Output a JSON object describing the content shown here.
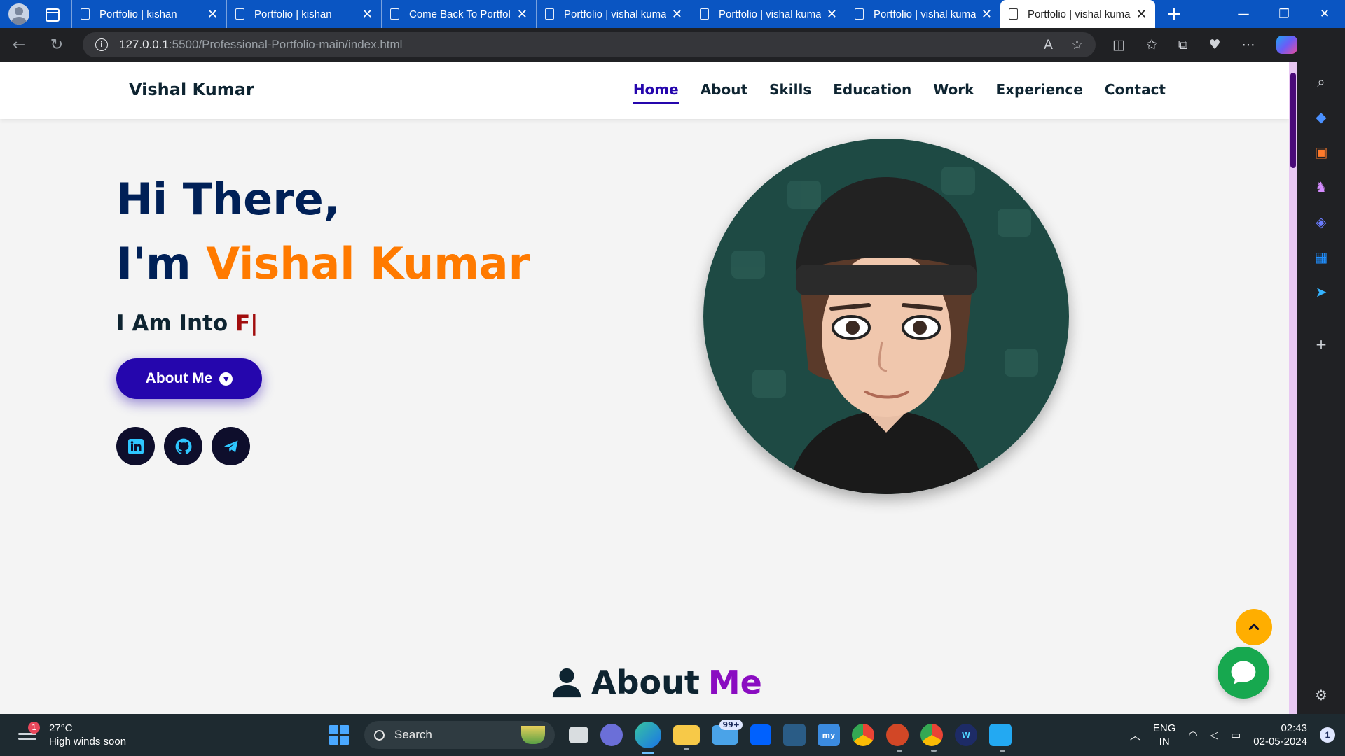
{
  "browser": {
    "tabs": [
      {
        "title": "Portfolio | kishan",
        "active": false
      },
      {
        "title": "Portfolio | kishan",
        "active": false
      },
      {
        "title": "Come Back To Portfolio",
        "active": false
      },
      {
        "title": "Portfolio | vishal kumar",
        "active": false
      },
      {
        "title": "Portfolio | vishal kumar",
        "active": false
      },
      {
        "title": "Portfolio | vishal kumar",
        "active": false
      },
      {
        "title": "Portfolio | vishal kumar",
        "active": true
      }
    ],
    "url_host": "127.0.0.1",
    "url_rest": ":5500/Professional-Portfolio-main/index.html"
  },
  "page": {
    "brand": "Vishal Kumar",
    "nav": [
      "Home",
      "About",
      "Skills",
      "Education",
      "Work",
      "Experience",
      "Contact"
    ],
    "active_nav": "Home",
    "greeting": "Hi There,",
    "im_prefix": "I'm ",
    "name": "Vishal Kumar",
    "into_prefix": "I Am Into ",
    "typed_text": "F|",
    "about_button": "About Me",
    "socials": [
      "linkedin-icon",
      "github-icon",
      "telegram-icon"
    ],
    "section_title_1": "About",
    "section_title_2": "Me",
    "colors": {
      "primary": "#2506ad",
      "heading": "#002057",
      "accent_orange": "#ff7a00",
      "accent_purple": "#8a0cc1",
      "scroll_top": "#ffae00",
      "chat": "#17a84f"
    }
  },
  "taskbar": {
    "weather_temp": "27°C",
    "weather_desc": "High winds soon",
    "weather_badge": "1",
    "search_label": "Search",
    "mail_badge": "99+",
    "lang_1": "ENG",
    "lang_2": "IN",
    "time": "02:43",
    "date": "02-05-2024",
    "notification_count": "1"
  }
}
